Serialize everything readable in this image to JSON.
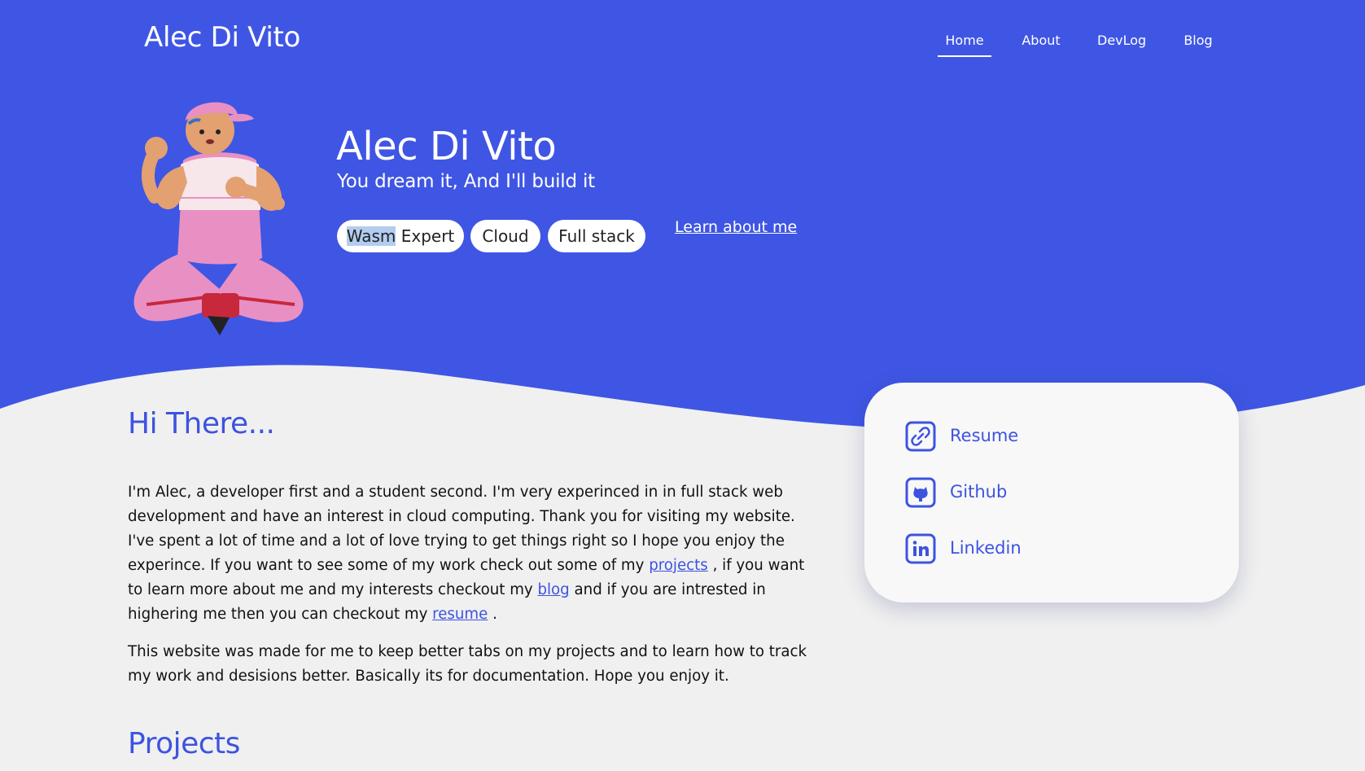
{
  "colors": {
    "accent": "#3d53e0",
    "hero_background": "#3f56e4",
    "page_background": "#f0f0f0",
    "card_background": "#f8f8f8"
  },
  "header": {
    "site_title": "Alec Di Vito",
    "nav": [
      {
        "label": "Home",
        "active": true
      },
      {
        "label": "About",
        "active": false
      },
      {
        "label": "DevLog",
        "active": false
      },
      {
        "label": "Blog",
        "active": false
      }
    ]
  },
  "hero": {
    "name": "Alec Di Vito",
    "tagline": "You dream it, And I'll build it",
    "chips": [
      {
        "highlighted": "Wasm",
        "label": " Expert"
      },
      {
        "label": "Cloud"
      },
      {
        "label": "Full stack"
      }
    ],
    "learn_link": "Learn about me"
  },
  "intro": {
    "heading": "Hi There...",
    "para1": {
      "text1": "I'm Alec, a developer first and a student second. I'm very experinced in in full stack web development and have an interest in cloud computing. Thank you for visiting my website. I've spent a lot of time and a lot of love trying to get things right so I hope you enjoy the experince. If you want to see some of my work check out some of my ",
      "link_projects": "projects",
      "text2": " , if you want to learn more about me and my interests checkout my ",
      "link_blog": "blog",
      "text3": " and if you are intrested in highering me then you can checkout my ",
      "link_resume": "resume",
      "text4": " ."
    },
    "para2": "This website was made for me to keep better tabs on my projects and to learn how to track my work and desisions better. Basically its for documentation. Hope you enjoy it."
  },
  "projects": {
    "heading": "Projects"
  },
  "links_card": {
    "items": [
      {
        "label": "Resume",
        "icon": "link-icon"
      },
      {
        "label": "Github",
        "icon": "github-icon"
      },
      {
        "label": "Linkedin",
        "icon": "linkedin-icon"
      }
    ]
  }
}
